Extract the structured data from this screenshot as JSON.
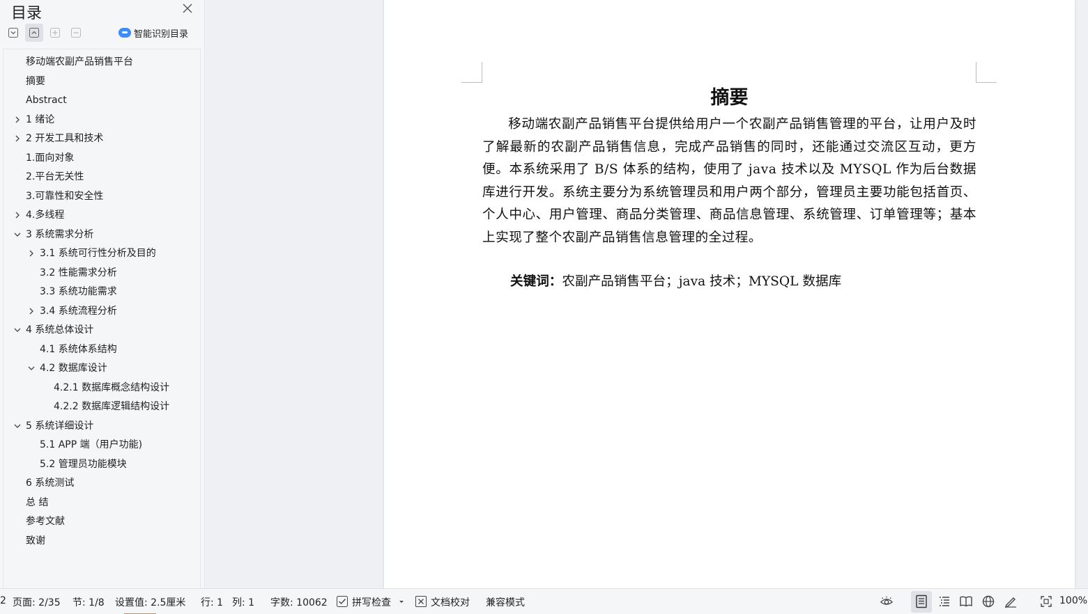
{
  "toc": {
    "title": "目录",
    "ai_button": "智能识别目录",
    "items": [
      {
        "label": "移动端农副产品销售平台",
        "level": 0,
        "chevron": "none"
      },
      {
        "label": "摘要",
        "level": 0,
        "chevron": "none"
      },
      {
        "label": "Abstract",
        "level": 0,
        "chevron": "none"
      },
      {
        "label": "1  绪论",
        "level": 0,
        "chevron": "right"
      },
      {
        "label": "2  开发工具和技术",
        "level": 0,
        "chevron": "right"
      },
      {
        "label": "1.面向对象",
        "level": 0,
        "chevron": "none"
      },
      {
        "label": "2.平台无关性",
        "level": 0,
        "chevron": "none"
      },
      {
        "label": "3.可靠性和安全性",
        "level": 0,
        "chevron": "none"
      },
      {
        "label": "4.多线程",
        "level": 0,
        "chevron": "right"
      },
      {
        "label": "3  系统需求分析",
        "level": 0,
        "chevron": "down"
      },
      {
        "label": "3.1  系统可行性分析及目的",
        "level": 1,
        "chevron": "right"
      },
      {
        "label": "3.2  性能需求分析",
        "level": 1,
        "chevron": "none"
      },
      {
        "label": "3.3 系统功能需求",
        "level": 1,
        "chevron": "none"
      },
      {
        "label": "3.4 系统流程分析",
        "level": 1,
        "chevron": "right"
      },
      {
        "label": "4    系统总体设计",
        "level": 0,
        "chevron": "down"
      },
      {
        "label": "4.1  系统体系结构",
        "level": 1,
        "chevron": "none"
      },
      {
        "label": "4.2 数据库设计",
        "level": 1,
        "chevron": "down"
      },
      {
        "label": "4.2.1  数据库概念结构设计",
        "level": 2,
        "chevron": "none"
      },
      {
        "label": "4.2.2 数据库逻辑结构设计",
        "level": 2,
        "chevron": "none"
      },
      {
        "label": "5  系统详细设计",
        "level": 0,
        "chevron": "down"
      },
      {
        "label": "5.1 APP 端（用户功能)",
        "level": 1,
        "chevron": "none"
      },
      {
        "label": "5.2 管理员功能模块",
        "level": 1,
        "chevron": "none"
      },
      {
        "label": "6  系统测试",
        "level": 0,
        "chevron": "none"
      },
      {
        "label": "总  结",
        "level": 0,
        "chevron": "none"
      },
      {
        "label": "参考文献",
        "level": 0,
        "chevron": "none"
      },
      {
        "label": "致谢",
        "level": 0,
        "chevron": "none"
      }
    ]
  },
  "document": {
    "heading": "摘要",
    "paragraph": "移动端农副产品销售平台提供给用户一个农副产品销售管理的平台，让用户及时了解最新的农副产品销售信息，完成产品销售的同时，还能通过交流区互动，更方便。本系统采用了 B/S 体系的结构，使用了 java 技术以及 MYSQL 作为后台数据库进行开发。系统主要分为系统管理员和用户两个部分，管理员主要功能包括首页、个人中心、用户管理、商品分类管理、商品信息管理、系统管理、订单管理等；基本上实现了整个农副产品销售信息管理的全过程。",
    "keywords_label": "关键词：",
    "keywords_value": "农副产品销售平台；java 技术；MYSQL 数据库"
  },
  "status_bar": {
    "edge_text": "2",
    "page": "页面: 2/35",
    "section": "节: 1/8",
    "setting": "设置值: 2.5厘米",
    "row": "行: 1",
    "col": "列: 1",
    "word_count": "字数: 10062",
    "spell_check": "拼写检查",
    "doc_proof": "文档校对",
    "compat_mode": "兼容模式",
    "zoom": "100%"
  },
  "colors": {
    "accent_blue": "#3d8bfd",
    "active_orange": "#e6822b"
  }
}
